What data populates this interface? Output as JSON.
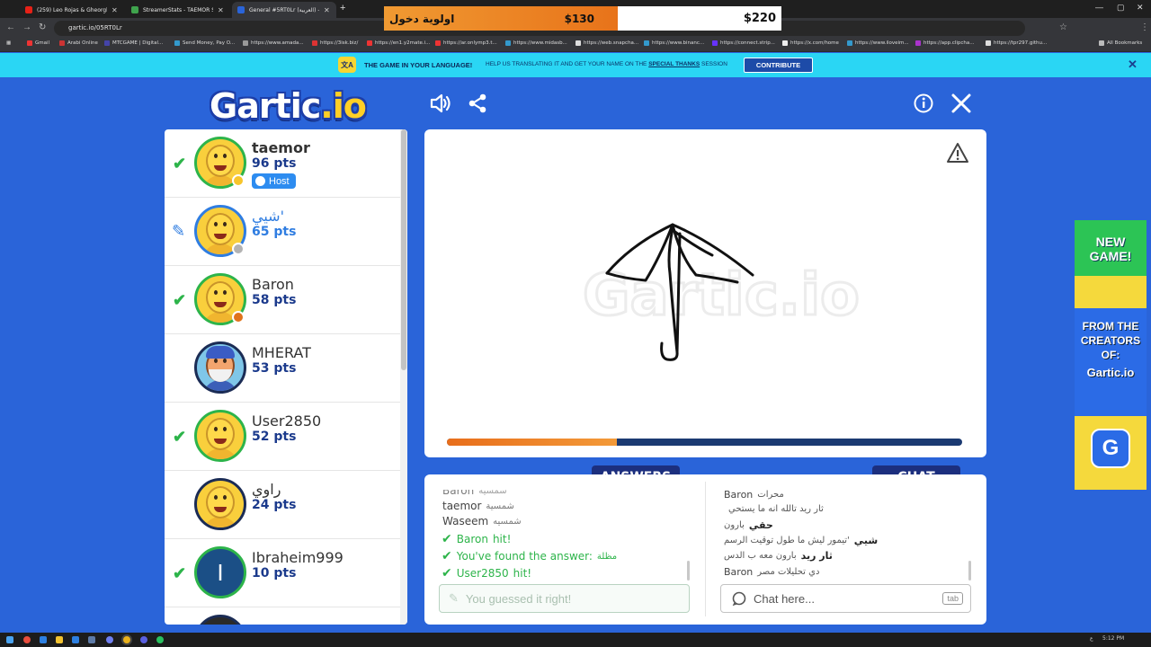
{
  "browser": {
    "tabs": [
      {
        "label": "(259) Leo Rojas & Gheorghe...",
        "color": "#e62117"
      },
      {
        "label": "StreamerStats - TAEMOR Stream...",
        "color": "#3fa34d"
      },
      {
        "label": "General #5RT0Lr (العربية) - Gart...",
        "color": "#2a64d9"
      }
    ],
    "url": "gartic.io/05RT0Lr",
    "bookmarks": [
      {
        "label": "Gmail",
        "color": "#e33"
      },
      {
        "label": "Arabi Online",
        "color": "#c33"
      },
      {
        "label": "MTCGAME | Digital...",
        "color": "#44a"
      },
      {
        "label": "Send Money, Pay O...",
        "color": "#39c"
      },
      {
        "label": "https://www.amada...",
        "color": "#999"
      },
      {
        "label": "https://3isk.biz/",
        "color": "#d33"
      },
      {
        "label": "https://en1.y2mate.i...",
        "color": "#e33"
      },
      {
        "label": "https://ar.onlymp3.t...",
        "color": "#e33"
      },
      {
        "label": "https://www.midasb...",
        "color": "#39c"
      },
      {
        "label": "https://web.snapcha...",
        "color": "#ddd"
      },
      {
        "label": "https://www.binanc...",
        "color": "#39c"
      },
      {
        "label": "https://connect.strip...",
        "color": "#63f"
      },
      {
        "label": "https://x.com/home",
        "color": "#eee"
      },
      {
        "label": "https://www.iloveim...",
        "color": "#39c"
      },
      {
        "label": "https://app.clipcha...",
        "color": "#a3c"
      },
      {
        "label": "https://tpr297.githu...",
        "color": "#ddd"
      }
    ],
    "all_bookmarks": "All Bookmarks"
  },
  "overlay": {
    "priority_label": "اولوية دخول",
    "left_amount": "$130",
    "right_amount": "$220"
  },
  "banner": {
    "icon_text": "文A",
    "headline": "THE GAME IN YOUR LANGUAGE!",
    "text_before": "HELP US TRANSLATING IT AND GET YOUR NAME ON THE",
    "link": "SPECIAL THANKS",
    "text_after": "SESSION",
    "button": "CONTRIBUTE"
  },
  "game": {
    "logo_main": "Gartic",
    "logo_accent": ".io",
    "players": [
      {
        "name": "taemor",
        "points": "96 pts",
        "status": "check",
        "host": "Host",
        "dot": "#f7c52b"
      },
      {
        "name": "شيي'",
        "points": "65 pts",
        "status": "drawing",
        "dot": "#b3b3b3",
        "highlight": true
      },
      {
        "name": "Baron",
        "points": "58 pts",
        "status": "check",
        "dot": "#e0731b"
      },
      {
        "name": "MHERAT",
        "points": "53 pts",
        "status": "none"
      },
      {
        "name": "User2850",
        "points": "52 pts",
        "status": "check"
      },
      {
        "name": "راوي",
        "points": "24 pts",
        "status": "none"
      },
      {
        "name": "Ibraheim999",
        "points": "10 pts",
        "status": "check",
        "initial": "I"
      }
    ],
    "timer_fraction": 0.33
  },
  "answers": {
    "title": "ANSWERS",
    "lines": [
      {
        "who": "Baron",
        "text": "شمسية",
        "type": "guess"
      },
      {
        "who": "taemor",
        "text": "شمسية",
        "type": "guess"
      },
      {
        "who": "Waseem",
        "text": "شمسيه",
        "type": "guess"
      },
      {
        "who": "Baron",
        "text": "hit!",
        "type": "hit"
      },
      {
        "who": "You've found the answer:",
        "text": "مظلة",
        "type": "found"
      },
      {
        "who": "User2850",
        "text": "hit!",
        "type": "hit"
      }
    ],
    "placeholder": "You guessed it right!"
  },
  "chat": {
    "title": "CHAT",
    "lines": [
      {
        "who": "Baron",
        "text": "محرات"
      },
      {
        "who": "",
        "text": "ثار ريد تالله انه ما يستحي"
      },
      {
        "who": "حقي",
        "text": "بارون"
      },
      {
        "who": "شيي",
        "text": "تيمور ليش ما طول توقيت الرسم'"
      },
      {
        "who": "ثار ريد",
        "text": "بارون معه ب الدس"
      },
      {
        "who": "Baron",
        "text": "دي تحليلات مصر"
      }
    ],
    "placeholder": "Chat here...",
    "tab_hint": "tab"
  },
  "ad": {
    "new_game": "NEW GAME!",
    "from": "FROM THE CREATORS OF:",
    "logo": "Gartic.io",
    "icon": "G"
  },
  "taskbar": {
    "time": "5:12 PM",
    "lang": "ع"
  }
}
